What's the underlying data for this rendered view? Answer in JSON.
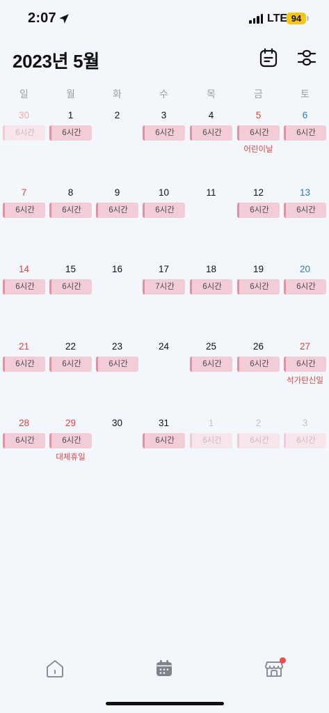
{
  "status_bar": {
    "time": "2:07",
    "network": "LTE",
    "battery": "94"
  },
  "header": {
    "title": "2023년 5월",
    "memo_icon": "memo-icon",
    "filter_icon": "filter-icon"
  },
  "weekdays": [
    "일",
    "월",
    "화",
    "수",
    "목",
    "금",
    "토"
  ],
  "weeks": [
    [
      {
        "day": "30",
        "faded": true,
        "shift": "6시간",
        "holiday": ""
      },
      {
        "day": "1",
        "faded": false,
        "shift": "6시간",
        "holiday": ""
      },
      {
        "day": "2",
        "faded": false,
        "shift": "",
        "holiday": ""
      },
      {
        "day": "3",
        "faded": false,
        "shift": "6시간",
        "holiday": ""
      },
      {
        "day": "4",
        "faded": false,
        "shift": "6시간",
        "holiday": ""
      },
      {
        "day": "5",
        "faded": false,
        "shift": "6시간",
        "holiday": "어린이날",
        "red": true
      },
      {
        "day": "6",
        "faded": false,
        "shift": "6시간",
        "holiday": ""
      }
    ],
    [
      {
        "day": "7",
        "faded": false,
        "shift": "6시간",
        "holiday": ""
      },
      {
        "day": "8",
        "faded": false,
        "shift": "6시간",
        "holiday": ""
      },
      {
        "day": "9",
        "faded": false,
        "shift": "6시간",
        "holiday": ""
      },
      {
        "day": "10",
        "faded": false,
        "shift": "6시간",
        "holiday": ""
      },
      {
        "day": "11",
        "faded": false,
        "shift": "",
        "holiday": ""
      },
      {
        "day": "12",
        "faded": false,
        "shift": "6시간",
        "holiday": ""
      },
      {
        "day": "13",
        "faded": false,
        "shift": "6시간",
        "holiday": ""
      }
    ],
    [
      {
        "day": "14",
        "faded": false,
        "shift": "6시간",
        "holiday": ""
      },
      {
        "day": "15",
        "faded": false,
        "shift": "6시간",
        "holiday": ""
      },
      {
        "day": "16",
        "faded": false,
        "shift": "",
        "holiday": ""
      },
      {
        "day": "17",
        "faded": false,
        "shift": "7시간",
        "holiday": ""
      },
      {
        "day": "18",
        "faded": false,
        "shift": "6시간",
        "holiday": ""
      },
      {
        "day": "19",
        "faded": false,
        "shift": "6시간",
        "holiday": ""
      },
      {
        "day": "20",
        "faded": false,
        "shift": "6시간",
        "holiday": ""
      }
    ],
    [
      {
        "day": "21",
        "faded": false,
        "shift": "6시간",
        "holiday": ""
      },
      {
        "day": "22",
        "faded": false,
        "shift": "6시간",
        "holiday": ""
      },
      {
        "day": "23",
        "faded": false,
        "shift": "6시간",
        "holiday": ""
      },
      {
        "day": "24",
        "faded": false,
        "shift": "",
        "holiday": ""
      },
      {
        "day": "25",
        "faded": false,
        "shift": "6시간",
        "holiday": ""
      },
      {
        "day": "26",
        "faded": false,
        "shift": "6시간",
        "holiday": ""
      },
      {
        "day": "27",
        "faded": false,
        "shift": "6시간",
        "holiday": "석가탄신일",
        "red": true
      }
    ],
    [
      {
        "day": "28",
        "faded": false,
        "shift": "6시간",
        "holiday": ""
      },
      {
        "day": "29",
        "faded": false,
        "shift": "6시간",
        "holiday": "대체휴일",
        "red": true
      },
      {
        "day": "30",
        "faded": false,
        "shift": "",
        "holiday": ""
      },
      {
        "day": "31",
        "faded": false,
        "shift": "6시간",
        "holiday": ""
      },
      {
        "day": "1",
        "faded": true,
        "shift": "6시간",
        "holiday": ""
      },
      {
        "day": "2",
        "faded": true,
        "shift": "6시간",
        "holiday": ""
      },
      {
        "day": "3",
        "faded": true,
        "shift": "6시간",
        "holiday": ""
      }
    ]
  ],
  "colors": {
    "background": "#f3f6fa",
    "sunday": "#e04343",
    "saturday": "#2a7cc7",
    "shift_fill": "#f2cdd8",
    "shift_accent": "#e190a6",
    "badge": "#f04a4a",
    "battery": "#f5c518"
  },
  "tabbar": [
    {
      "name": "home",
      "icon": "home-icon"
    },
    {
      "name": "calendar",
      "icon": "calendar-icon",
      "active": true
    },
    {
      "name": "store",
      "icon": "store-icon",
      "badge": true
    }
  ]
}
